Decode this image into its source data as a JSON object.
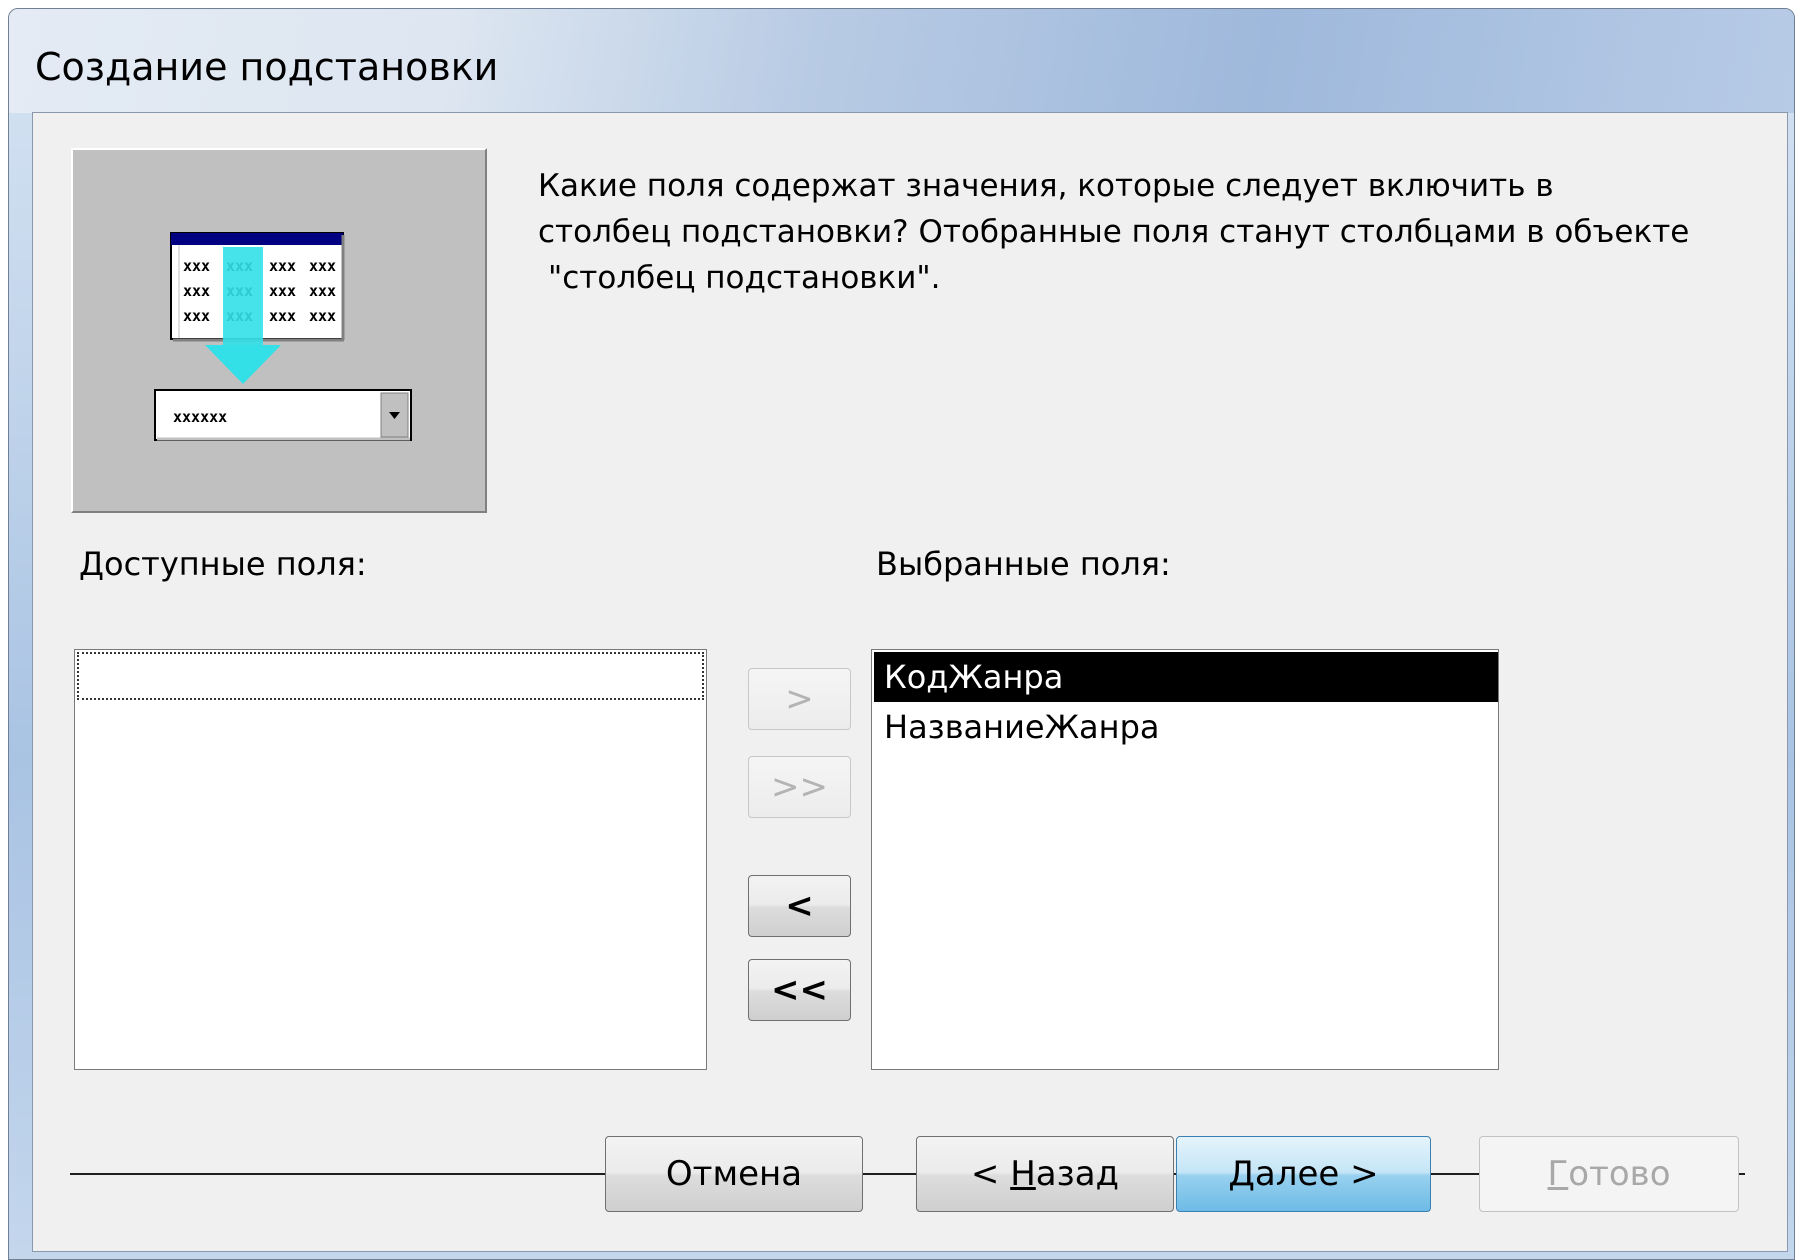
{
  "window": {
    "title": "Создание подстановки"
  },
  "prompt": {
    "line1": "Какие поля содержат значения, которые следует включить в",
    "line2": "столбец подстановки? Отобранные поля станут столбцами в объекте",
    "line3": "\"столбец подстановки\"."
  },
  "illustration": {
    "icon": "lookup-wizard-illustration",
    "grid_cell_text": "xxx",
    "combo_text": "xxxxxx"
  },
  "available": {
    "label": "Доступные поля:",
    "items": []
  },
  "selected": {
    "label": "Выбранные поля:",
    "items": [
      "КодЖанра",
      "НазваниеЖанра"
    ],
    "selected_index": 0
  },
  "move_buttons": {
    "add": ">",
    "add_all": ">>",
    "remove": "<",
    "remove_all": "<<"
  },
  "footer": {
    "cancel": "Отмена",
    "back_prefix": "< ",
    "back_hotkey": "Н",
    "back_rest": "азад",
    "next_hotkey": "Д",
    "next_rest": "алее >",
    "finish_hotkey": "Г",
    "finish_rest": "отово"
  },
  "colors": {
    "selection_bg": "#000000",
    "arrow": "#33e0e8",
    "default_button": "#98d1ef"
  }
}
